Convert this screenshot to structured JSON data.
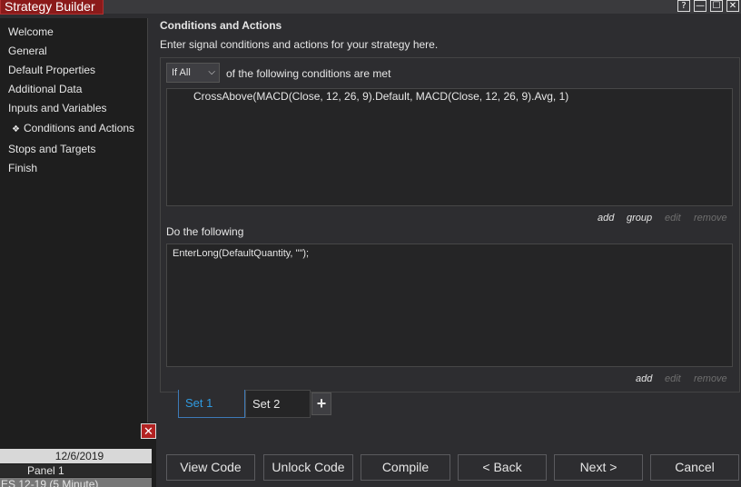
{
  "window": {
    "title": "Strategy Builder",
    "controls": [
      "?",
      "—",
      "☐",
      "✕"
    ]
  },
  "sidebar": {
    "items": [
      {
        "label": "Welcome"
      },
      {
        "label": "General"
      },
      {
        "label": "Default Properties"
      },
      {
        "label": "Additional Data"
      },
      {
        "label": "Inputs and Variables"
      },
      {
        "label": "Conditions and Actions",
        "selected": true
      },
      {
        "label": "Stops and Targets"
      },
      {
        "label": "Finish"
      }
    ],
    "selected_marker": "❖"
  },
  "main": {
    "title": "Conditions and Actions",
    "description": "Enter signal conditions and actions for your strategy here.",
    "condition_mode": {
      "value": "If All",
      "suffix": "of the following conditions are met"
    },
    "conditions": [
      "CrossAbove(MACD(Close, 12, 26, 9).Default, MACD(Close, 12, 26, 9).Avg, 1)"
    ],
    "condition_links": {
      "add": "add",
      "group": "group",
      "edit": "edit",
      "remove": "remove"
    },
    "actions_label": "Do the following",
    "actions": [
      "EnterLong(DefaultQuantity, \"\");"
    ],
    "action_links": {
      "add": "add",
      "edit": "edit",
      "remove": "remove"
    }
  },
  "sets": {
    "tabs": [
      "Set 1",
      "Set 2"
    ],
    "active": "Set 1",
    "add_label": "+"
  },
  "buttons": {
    "view_code": "View Code",
    "unlock_code": "Unlock Code",
    "compile": "Compile",
    "back": "< Back",
    "next": "Next >",
    "cancel": "Cancel"
  },
  "mini_chart_panel": {
    "date": "12/6/2019",
    "panel": "Panel 1",
    "series": "ES 12-19 (5 Minute)",
    "close_icon": "close-icon"
  },
  "colors": {
    "title_tab": "#8b1a1a",
    "active_set": "#2f9ae0",
    "background": "#2d2d30"
  }
}
